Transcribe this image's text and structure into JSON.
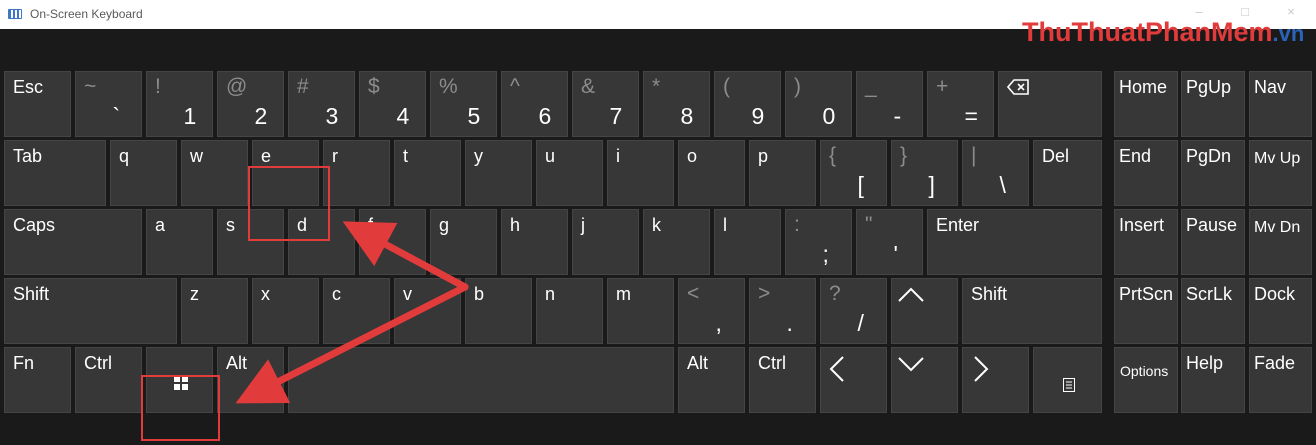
{
  "window": {
    "title": "On-Screen Keyboard",
    "minimize_glyph": "–",
    "maximize_glyph": "□",
    "close_glyph": "×"
  },
  "watermark": {
    "brand": "ThuThuatPhanMem",
    "tld": ".vn"
  },
  "colors": {
    "key": "#373737",
    "key_border": "#454545",
    "background": "#1a1a1a",
    "annotation": "#e23b3b"
  },
  "rows": {
    "numbers": [
      {
        "name": "esc",
        "label": "Esc"
      },
      {
        "name": "backtick",
        "shift": "~",
        "primary": "`"
      },
      {
        "name": "1",
        "shift": "!",
        "primary": "1"
      },
      {
        "name": "2",
        "shift": "@",
        "primary": "2"
      },
      {
        "name": "3",
        "shift": "#",
        "primary": "3"
      },
      {
        "name": "4",
        "shift": "$",
        "primary": "4"
      },
      {
        "name": "5",
        "shift": "%",
        "primary": "5"
      },
      {
        "name": "6",
        "shift": "^",
        "primary": "6"
      },
      {
        "name": "7",
        "shift": "&",
        "primary": "7"
      },
      {
        "name": "8",
        "shift": "*",
        "primary": "8"
      },
      {
        "name": "9",
        "shift": "(",
        "primary": "9"
      },
      {
        "name": "0",
        "shift": ")",
        "primary": "0"
      },
      {
        "name": "minus",
        "shift": "_",
        "primary": "-"
      },
      {
        "name": "equals",
        "shift": "+",
        "primary": "="
      },
      {
        "name": "backspace",
        "icon": "backspace-icon"
      }
    ],
    "qwerty": [
      {
        "name": "tab",
        "label": "Tab"
      },
      {
        "name": "q",
        "label": "q"
      },
      {
        "name": "w",
        "label": "w"
      },
      {
        "name": "e",
        "label": "e"
      },
      {
        "name": "r",
        "label": "r"
      },
      {
        "name": "t",
        "label": "t"
      },
      {
        "name": "y",
        "label": "y"
      },
      {
        "name": "u",
        "label": "u"
      },
      {
        "name": "i",
        "label": "i"
      },
      {
        "name": "o",
        "label": "o"
      },
      {
        "name": "p",
        "label": "p"
      },
      {
        "name": "open-bracket",
        "shift": "{",
        "primary": "["
      },
      {
        "name": "close-bracket",
        "shift": "}",
        "primary": "]"
      },
      {
        "name": "backslash",
        "shift": "|",
        "primary": "\\"
      },
      {
        "name": "del",
        "label": "Del"
      }
    ],
    "home": [
      {
        "name": "caps",
        "label": "Caps"
      },
      {
        "name": "a",
        "label": "a"
      },
      {
        "name": "s",
        "label": "s"
      },
      {
        "name": "d",
        "label": "d"
      },
      {
        "name": "f",
        "label": "f"
      },
      {
        "name": "g",
        "label": "g"
      },
      {
        "name": "h",
        "label": "h"
      },
      {
        "name": "j",
        "label": "j"
      },
      {
        "name": "k",
        "label": "k"
      },
      {
        "name": "l",
        "label": "l"
      },
      {
        "name": "semicolon",
        "shift": ":",
        "primary": ";"
      },
      {
        "name": "quote",
        "shift": "\"",
        "primary": "'"
      },
      {
        "name": "enter",
        "label": "Enter"
      }
    ],
    "bottom_letters": [
      {
        "name": "shift-left",
        "label": "Shift"
      },
      {
        "name": "z",
        "label": "z"
      },
      {
        "name": "x",
        "label": "x"
      },
      {
        "name": "c",
        "label": "c"
      },
      {
        "name": "v",
        "label": "v"
      },
      {
        "name": "b",
        "label": "b"
      },
      {
        "name": "n",
        "label": "n"
      },
      {
        "name": "m",
        "label": "m"
      },
      {
        "name": "comma",
        "shift": "<",
        "primary": ","
      },
      {
        "name": "period",
        "shift": ">",
        "primary": "."
      },
      {
        "name": "slash",
        "shift": "?",
        "primary": "/"
      },
      {
        "name": "arrow-up",
        "glyph": "^"
      },
      {
        "name": "shift-right",
        "label": "Shift"
      }
    ],
    "modifiers": [
      {
        "name": "fn",
        "label": "Fn"
      },
      {
        "name": "ctrl-left",
        "label": "Ctrl"
      },
      {
        "name": "windows",
        "icon": "windows-icon"
      },
      {
        "name": "alt-left",
        "label": "Alt"
      },
      {
        "name": "space",
        "label": ""
      },
      {
        "name": "alt-right",
        "label": "Alt"
      },
      {
        "name": "ctrl-right",
        "label": "Ctrl"
      },
      {
        "name": "arrow-left",
        "glyph": "<"
      },
      {
        "name": "arrow-down",
        "glyph": "v"
      },
      {
        "name": "arrow-right",
        "glyph": ">"
      },
      {
        "name": "menu",
        "icon": "menu-icon"
      }
    ]
  },
  "side": {
    "col1": [
      "Home",
      "End",
      "Insert",
      "PrtScn",
      "Options"
    ],
    "col2": [
      "PgUp",
      "PgDn",
      "Pause",
      "ScrLk",
      "Help"
    ],
    "col3": [
      "Nav",
      "Mv Up",
      "Mv Dn",
      "Dock",
      "Fade"
    ]
  },
  "annotations": {
    "highlighted_keys": [
      "e",
      "windows"
    ],
    "arrows": [
      "arrow-to-e-key",
      "arrow-to-windows-key"
    ]
  }
}
